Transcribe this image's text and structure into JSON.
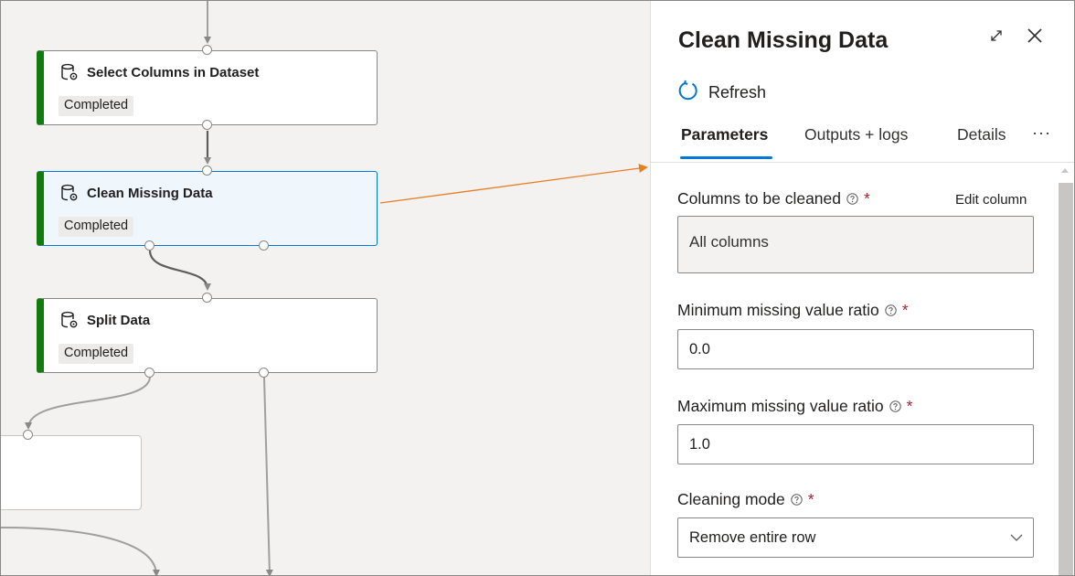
{
  "canvas": {
    "nodes": [
      {
        "name": "Select Columns in Dataset",
        "status": "Completed"
      },
      {
        "name": "Clean Missing Data",
        "status": "Completed"
      },
      {
        "name": "Split Data",
        "status": "Completed"
      }
    ]
  },
  "panel": {
    "title": "Clean Missing Data",
    "expand_icon": "expand-icon",
    "close_icon": "close-icon",
    "refresh_label": "Refresh",
    "tabs": [
      {
        "label": "Parameters",
        "active": true
      },
      {
        "label": "Outputs + logs",
        "active": false
      },
      {
        "label": "Details",
        "active": false
      }
    ],
    "more_tabs_label": "···",
    "fields": {
      "columns": {
        "label": "Columns to be cleaned",
        "required": "*",
        "edit_label": "Edit column",
        "value": "All columns"
      },
      "min_ratio": {
        "label": "Minimum missing value ratio",
        "required": "*",
        "value": "0.0"
      },
      "max_ratio": {
        "label": "Maximum missing value ratio",
        "required": "*",
        "value": "1.0"
      },
      "cleaning_mode": {
        "label": "Cleaning mode",
        "required": "*",
        "value": "Remove entire row"
      }
    }
  },
  "colors": {
    "completed": "#107c10",
    "accent": "#0078d4",
    "annotation_arrow": "#e67e22",
    "required": "#a4262c"
  }
}
